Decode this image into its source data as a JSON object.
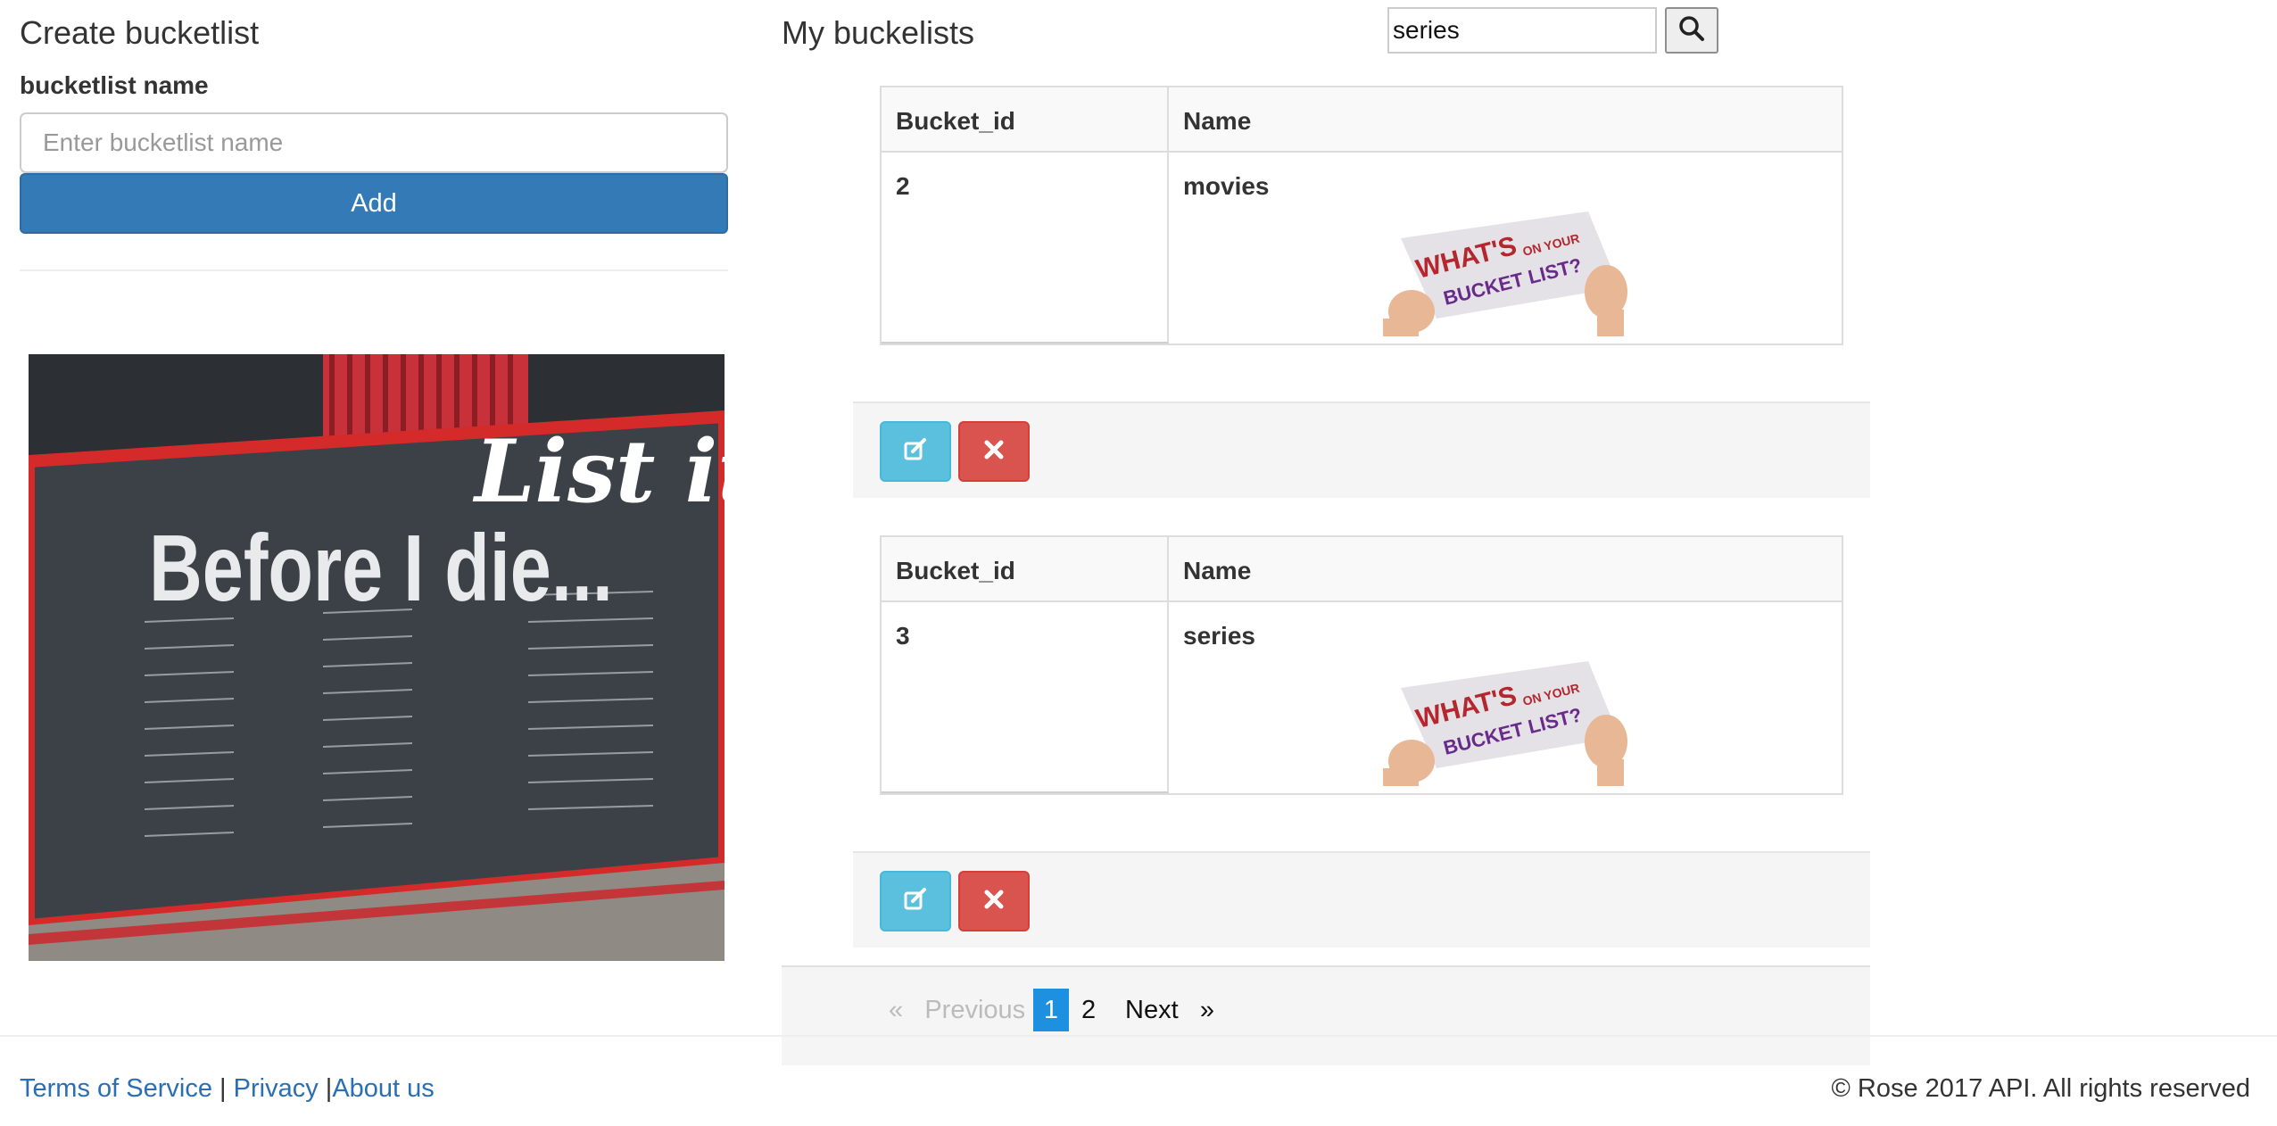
{
  "left": {
    "title": "Create bucketlist",
    "name_label": "bucketlist name",
    "name_placeholder": "Enter bucketlist name",
    "add_label": "Add",
    "image": {
      "heading_text": "Before I die...",
      "script_text": "List it!"
    }
  },
  "right": {
    "title": "My buckelists",
    "search": {
      "value": "series"
    },
    "buckets": [
      {
        "col_id": "Bucket_id",
        "col_name": "Name",
        "id": "2",
        "name": "movies",
        "sign_line1": "WHAT'S",
        "sign_line2": "ON YOUR",
        "sign_line3": "BUCKET LIST?"
      },
      {
        "col_id": "Bucket_id",
        "col_name": "Name",
        "id": "3",
        "name": "series",
        "sign_line1": "WHAT'S",
        "sign_line2": "ON YOUR",
        "sign_line3": "BUCKET LIST?"
      }
    ],
    "pagination": {
      "prev_arrow": "«",
      "prev_label": "Previous",
      "pages": [
        "1",
        "2"
      ],
      "next_label": "Next",
      "next_arrow": "»"
    }
  },
  "footer": {
    "terms": "Terms of Service",
    "sep1": "|",
    "privacy": "Privacy",
    "sep2": "|",
    "about": "About us",
    "copyright": "© Rose 2017 API. All rights reserved"
  },
  "colors": {
    "primary": "#337ab7",
    "info": "#5bc0de",
    "danger": "#d9534f",
    "active_page": "#1e90e0",
    "link": "#2a6fb3"
  },
  "icons": {
    "edit": "edit-icon",
    "delete": "close-icon",
    "search": "search-icon"
  }
}
